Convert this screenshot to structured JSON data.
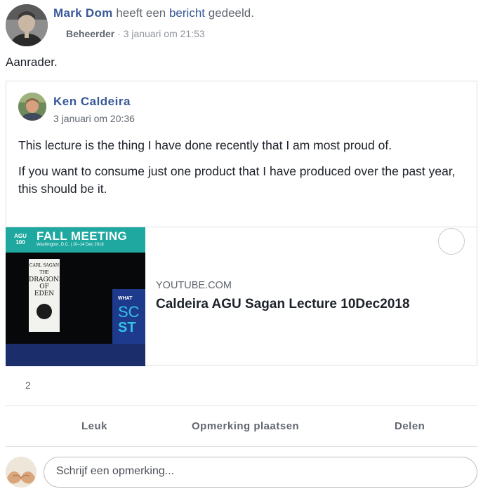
{
  "post": {
    "author": "Mark Dom",
    "action_text_1": "heeft een",
    "action_link": "bericht",
    "action_text_2": "gedeeld.",
    "role": "Beheerder",
    "separator": "·",
    "timestamp": "3 januari om 21:53",
    "text": "Aanrader."
  },
  "shared": {
    "author": "Ken Caldeira",
    "timestamp": "3 januari om 20:36",
    "paragraphs": [
      "This lecture is the thing I have done recently that I am most proud of.",
      "If you want to consume just one product that I have produced over the past year, this should be it."
    ],
    "link": {
      "domain": "YOUTUBE.COM",
      "title": "Caldeira AGU Sagan Lecture 10Dec2018",
      "thumbnail": {
        "logo_line1": "AGU",
        "logo_line2": "100",
        "banner_title": "FALL MEETING",
        "banner_sub": "Washington, D.C. | 10–14 Dec 2018",
        "book_author": "CARL SAGAN",
        "book_title_1": "THE",
        "book_title_2": "DRAGONS",
        "book_title_3": "OF EDEN",
        "side_text_1": "WHAT",
        "side_text_2": "SC",
        "side_text_3": "ST"
      }
    }
  },
  "reactions": {
    "count": "2"
  },
  "actions": {
    "like": "Leuk",
    "comment": "Opmerking plaatsen",
    "share": "Delen"
  },
  "comment": {
    "placeholder": "Schrijf een opmerking..."
  },
  "colors": {
    "link_blue": "#385898",
    "meta_gray": "#616770",
    "agu_teal": "#1fa89f",
    "border": "#dddfe2"
  }
}
